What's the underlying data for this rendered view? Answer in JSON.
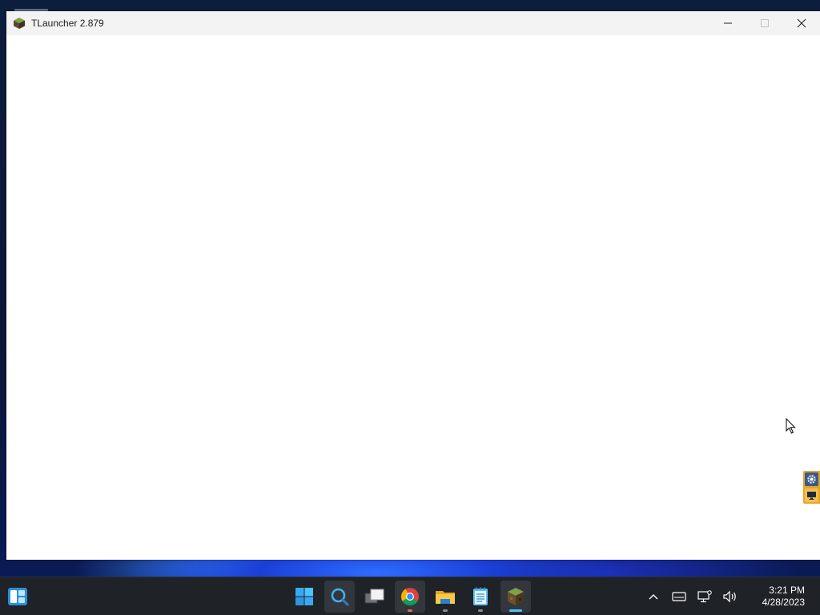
{
  "window": {
    "title": "TLauncher 2.879"
  },
  "taskbar": {
    "apps": [
      {
        "name": "start-button",
        "icon": "windows-logo-icon"
      },
      {
        "name": "search-button",
        "icon": "search-icon"
      },
      {
        "name": "task-view-button",
        "icon": "task-view-icon"
      },
      {
        "name": "chrome-button",
        "icon": "chrome-icon"
      },
      {
        "name": "file-explorer-button",
        "icon": "folder-icon"
      },
      {
        "name": "notepad-button",
        "icon": "notepad-icon"
      },
      {
        "name": "tlauncher-button",
        "icon": "tlauncher-icon"
      }
    ],
    "clock": {
      "time": "3:21 PM",
      "date": "4/28/2023"
    }
  },
  "colors": {
    "taskbar_bg": "#1f2227",
    "titlebar_bg": "#f3f3f3",
    "accent": "#4cc2ff"
  }
}
